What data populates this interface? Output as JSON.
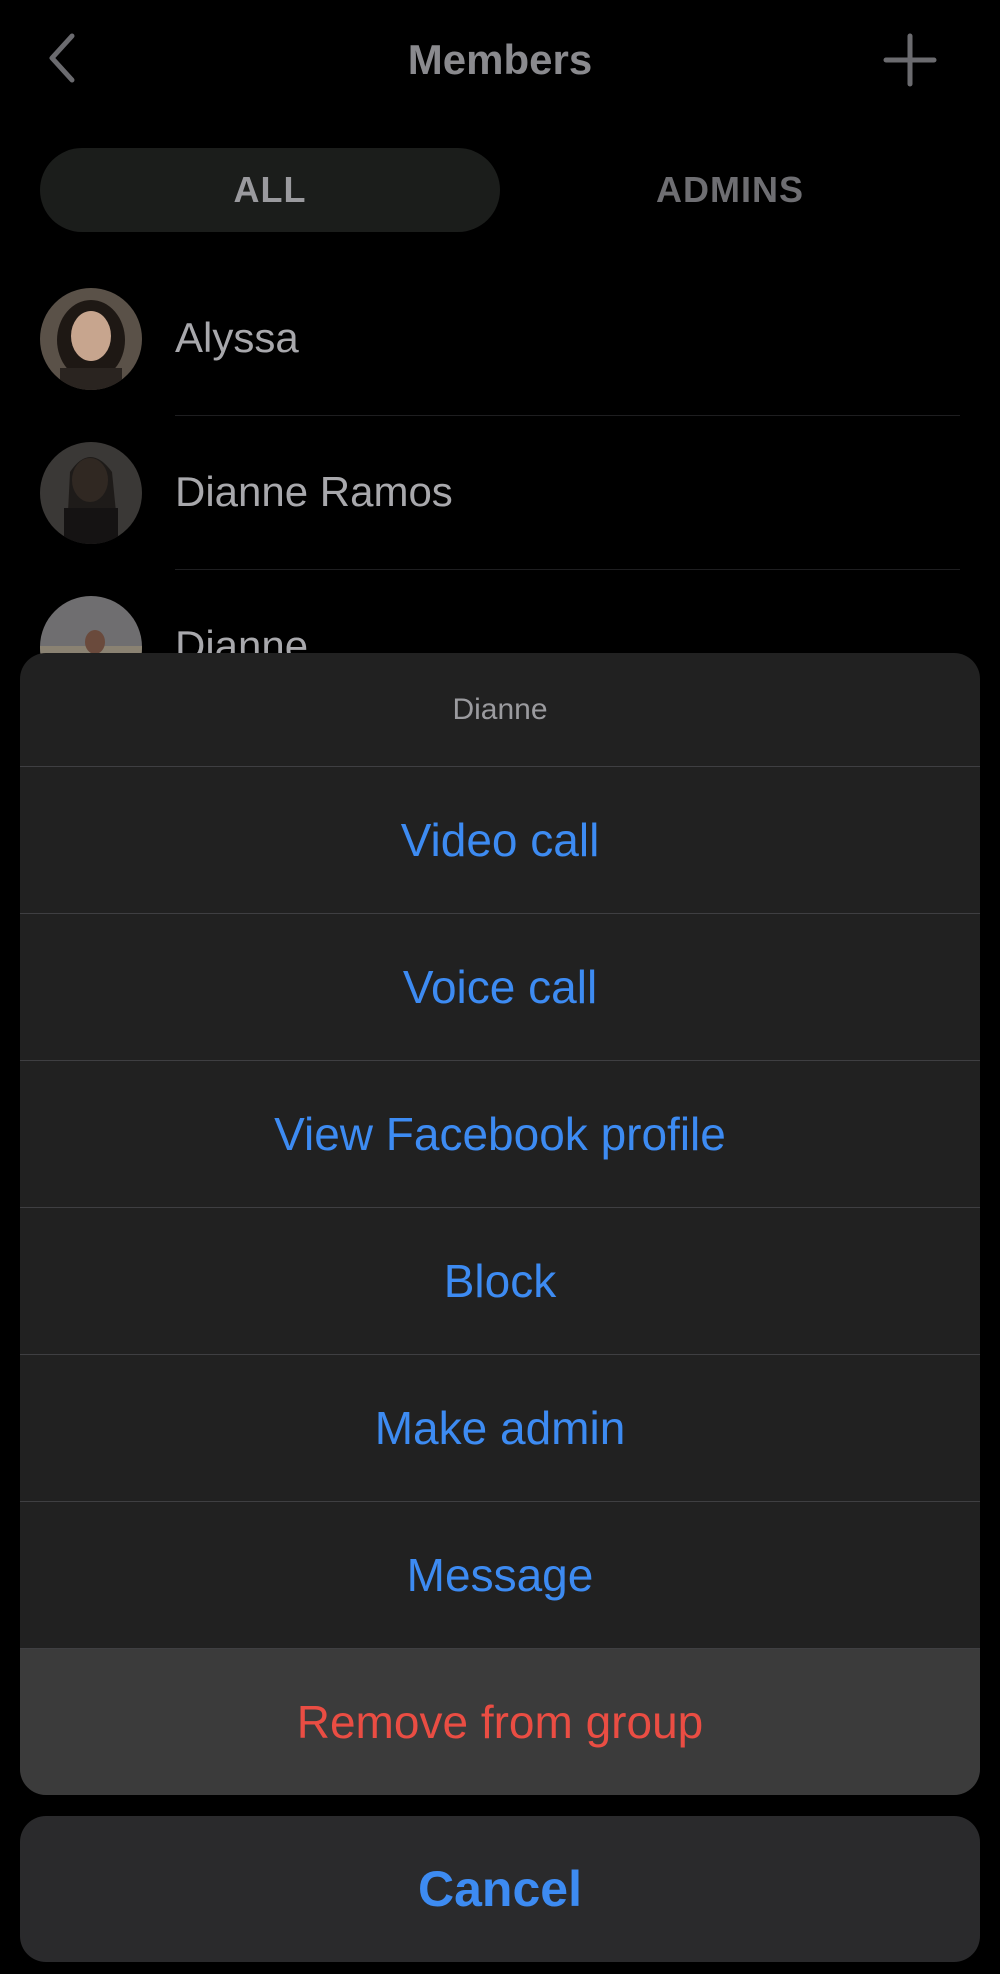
{
  "nav": {
    "title": "Members",
    "back_icon": "chevron-left-icon",
    "add_icon": "plus-icon"
  },
  "tabs": [
    {
      "label": "ALL",
      "selected": true
    },
    {
      "label": "ADMINS",
      "selected": false
    }
  ],
  "members": [
    {
      "name": "Alyssa"
    },
    {
      "name": "Dianne Ramos"
    },
    {
      "name": "Dianne"
    }
  ],
  "action_sheet": {
    "title": "Dianne",
    "items": [
      {
        "label": "Video call"
      },
      {
        "label": "Voice call"
      },
      {
        "label": "View Facebook profile"
      },
      {
        "label": "Block"
      },
      {
        "label": "Make admin"
      },
      {
        "label": "Message"
      },
      {
        "label": "Remove from group",
        "style": "destructive"
      }
    ],
    "cancel_label": "Cancel"
  },
  "colors": {
    "accent": "#3d8bf2",
    "destructive": "#ea4d43",
    "sheet_bg": "#212121",
    "background": "#000000"
  }
}
